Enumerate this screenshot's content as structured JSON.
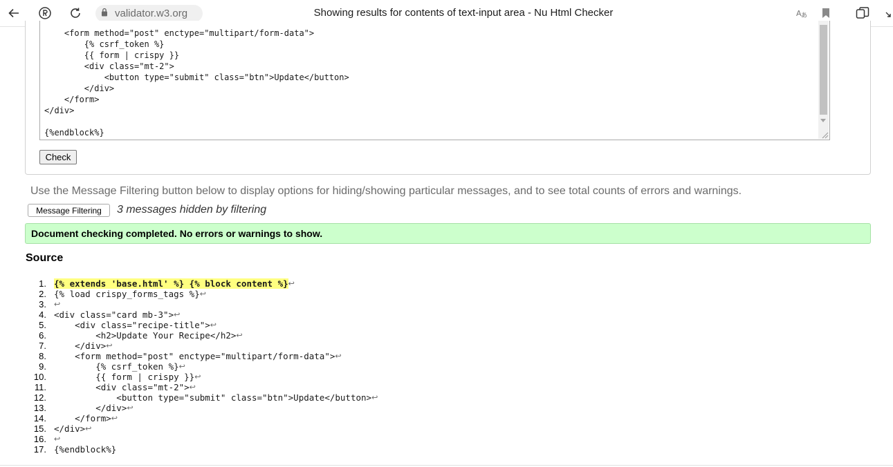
{
  "browser": {
    "url": "validator.w3.org",
    "tab_title": "Showing results for contents of text-input area - Nu Html Checker"
  },
  "textarea": {
    "lines": [
      "    <form method=\"post\" enctype=\"multipart/form-data\">",
      "        {% csrf_token %}",
      "        {{ form | crispy }}",
      "        <div class=\"mt-2\">",
      "            <button type=\"submit\" class=\"btn\">Update</button>",
      "        </div>",
      "    </form>",
      "</div>",
      "",
      "{%endblock%}"
    ]
  },
  "check_button": "Check",
  "filter_note": "Use the Message Filtering button below to display options for hiding/showing particular messages, and to see total counts of errors and warnings.",
  "filter_button": "Message Filtering",
  "hidden_messages": "3 messages hidden by filtering",
  "success_message": "Document checking completed. No errors or warnings to show.",
  "source_heading": "Source",
  "source_lines": [
    {
      "num": "1.",
      "code": "{% extends 'base.html' %} {% block content %}",
      "highlight": true
    },
    {
      "num": "2.",
      "code": "{% load crispy_forms_tags %}",
      "highlight": false
    },
    {
      "num": "3.",
      "code": "",
      "highlight": false
    },
    {
      "num": "4.",
      "code": "<div class=\"card mb-3\">",
      "highlight": false
    },
    {
      "num": "5.",
      "code": "    <div class=\"recipe-title\">",
      "highlight": false
    },
    {
      "num": "6.",
      "code": "        <h2>Update Your Recipe</h2>",
      "highlight": false
    },
    {
      "num": "7.",
      "code": "    </div>",
      "highlight": false
    },
    {
      "num": "8.",
      "code": "    <form method=\"post\" enctype=\"multipart/form-data\">",
      "highlight": false
    },
    {
      "num": "9.",
      "code": "        {% csrf_token %}",
      "highlight": false
    },
    {
      "num": "10.",
      "code": "        {{ form | crispy }}",
      "highlight": false
    },
    {
      "num": "11.",
      "code": "        <div class=\"mt-2\">",
      "highlight": false
    },
    {
      "num": "12.",
      "code": "            <button type=\"submit\" class=\"btn\">Update</button>",
      "highlight": false
    },
    {
      "num": "13.",
      "code": "        </div>",
      "highlight": false
    },
    {
      "num": "14.",
      "code": "    </form>",
      "highlight": false
    },
    {
      "num": "15.",
      "code": "</div>",
      "highlight": false
    },
    {
      "num": "16.",
      "code": "",
      "highlight": false
    },
    {
      "num": "17.",
      "code": "{%endblock%}",
      "highlight": false
    }
  ],
  "return_glyph": "↩",
  "icons": [
    "back-icon",
    "profile-icon",
    "reload-icon",
    "lock-icon",
    "translate-icon",
    "bookmark-icon",
    "collections-icon",
    "minimize-icon"
  ]
}
